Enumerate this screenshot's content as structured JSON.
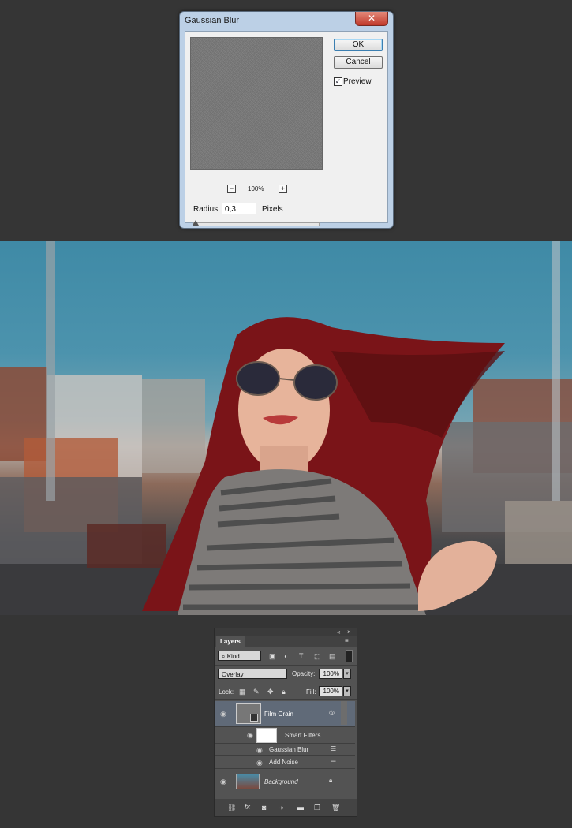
{
  "dialog": {
    "title": "Gaussian Blur",
    "close_label": "✕",
    "ok_label": "OK",
    "cancel_label": "Cancel",
    "preview_label": "Preview",
    "preview_checked": "✓",
    "zoom_out": "−",
    "zoom_in": "+",
    "zoom_level": "100%",
    "radius_label": "Radius:",
    "radius_value": "0,3",
    "radius_unit": "Pixels"
  },
  "layers_panel": {
    "tab_label": "Layers",
    "filter_kind": "Kind",
    "blend_mode": "Overlay",
    "opacity_label": "Opacity:",
    "opacity_value": "100%",
    "lock_label": "Lock:",
    "fill_label": "Fill:",
    "fill_value": "100%",
    "layers": [
      {
        "name": "Film Grain"
      },
      {
        "name": "Smart Filters"
      },
      {
        "name": "Gaussian Blur"
      },
      {
        "name": "Add Noise"
      },
      {
        "name": "Background"
      }
    ],
    "bottom_icons": [
      "link-icon",
      "fx-icon",
      "mask-icon",
      "adjustment-icon",
      "folder-icon",
      "new-layer-icon",
      "trash-icon"
    ],
    "fx_label": "fx"
  }
}
